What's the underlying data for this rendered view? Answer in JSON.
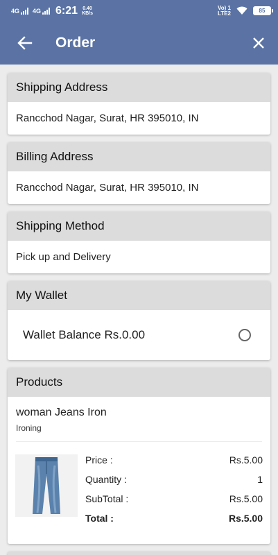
{
  "status_bar": {
    "net1": "4G",
    "net2": "4G",
    "time": "6:21",
    "speed_value": "0.40",
    "speed_unit": "KB/s",
    "volte_top": "Vo) 1",
    "volte_bottom": "LTE2",
    "battery": "85"
  },
  "appbar": {
    "title": "Order"
  },
  "shipping_address": {
    "header": "Shipping Address",
    "value": "Rancchod Nagar, Surat, HR 395010, IN"
  },
  "billing_address": {
    "header": "Billing Address",
    "value": "Rancchod Nagar, Surat, HR 395010, IN"
  },
  "shipping_method": {
    "header": "Shipping Method",
    "value": "Pick up and Delivery"
  },
  "wallet": {
    "header": "My Wallet",
    "balance_label": "Wallet Balance Rs.0.00"
  },
  "products": {
    "header": "Products",
    "items": [
      {
        "name": "woman Jeans Iron",
        "service": "Ironing",
        "price_label": "Price :",
        "price": "Rs.5.00",
        "quantity_label": "Quantity :",
        "quantity": "1",
        "subtotal_label": "SubTotal :",
        "subtotal": "Rs.5.00",
        "total_label": "Total :",
        "total": "Rs.5.00"
      }
    ]
  },
  "colors": {
    "primary": "#5a73a4",
    "section_header": "#dcdcdc",
    "background": "#ececec"
  },
  "icons": [
    "back-arrow-icon",
    "close-icon",
    "wifi-icon",
    "signal-icon",
    "battery-icon",
    "jeans-product-image"
  ]
}
